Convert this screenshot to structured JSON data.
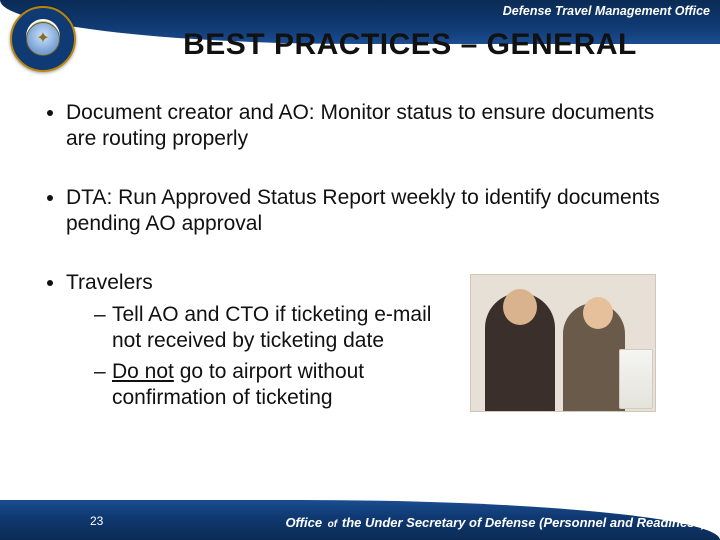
{
  "header": {
    "org_label": "Defense Travel Management Office",
    "seal_alt": "Department of Defense seal"
  },
  "title": "BEST PRACTICES – GENERAL",
  "bullets": {
    "b1": "Document creator and AO: Monitor status to ensure documents are routing properly",
    "b2": "DTA: Run Approved Status Report weekly to identify documents pending AO approval",
    "b3_label": "Travelers",
    "b3_sub1": "Tell AO and CTO if ticketing e-mail not received by ticketing date",
    "b3_sub2_prefix": "Do not",
    "b3_sub2_rest": " go to airport without confirmation of ticketing"
  },
  "footer": {
    "page_number": "23",
    "text_left": "Office ",
    "text_of": "of ",
    "text_right": "the Under Secretary of Defense (Personnel and Readiness)"
  }
}
